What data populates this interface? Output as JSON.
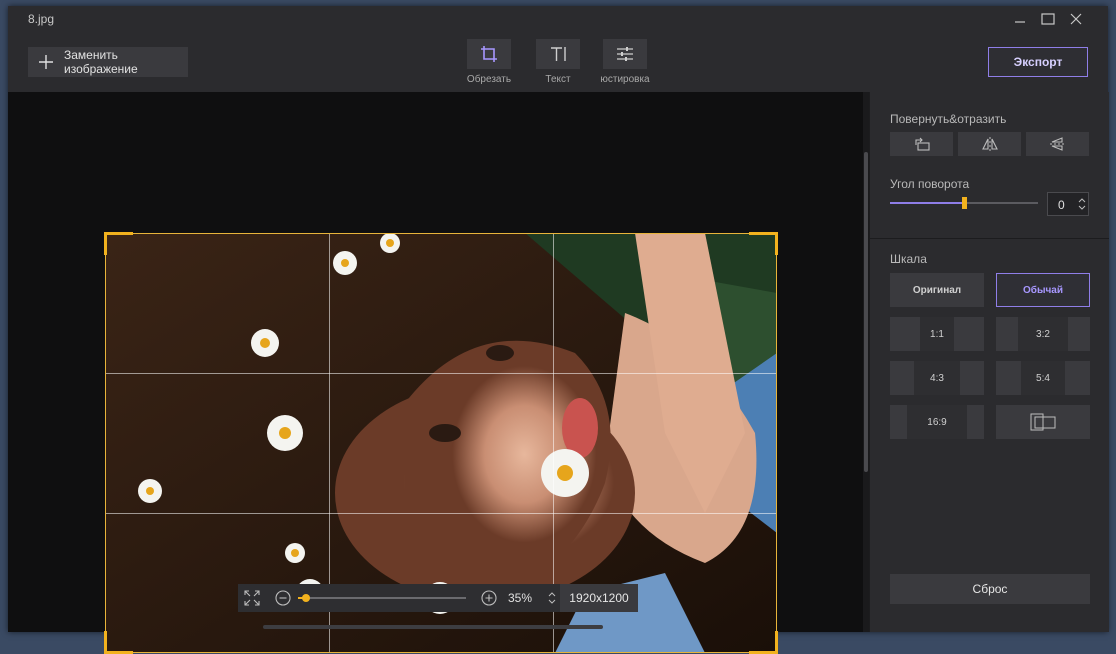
{
  "window": {
    "title": "8.jpg"
  },
  "toolbar": {
    "replace_label": "Заменить изображение",
    "tools": [
      {
        "label": "Обрезать",
        "icon": "crop-icon"
      },
      {
        "label": "Текст",
        "icon": "text-icon"
      },
      {
        "label": "юстировка",
        "icon": "adjust-icon"
      }
    ],
    "export_label": "Экспорт"
  },
  "zoom": {
    "value": "35%",
    "resolution": "1920x1200",
    "level": 0.05
  },
  "panel": {
    "rotate_title": "Повернуть&отразить",
    "angle_title": "Угол поворота",
    "angle_value": "0",
    "angle_level": 0.5,
    "scale_title": "Шкала",
    "original_label": "Оригинал",
    "normal_label": "Обычай",
    "ratios": [
      "1:1",
      "3:2",
      "4:3",
      "5:4",
      "16:9"
    ],
    "reset_label": "Сброс"
  },
  "colors": {
    "accent": "#8f7ee8",
    "crop": "#f2b21e",
    "background": "#2b2b2e"
  }
}
